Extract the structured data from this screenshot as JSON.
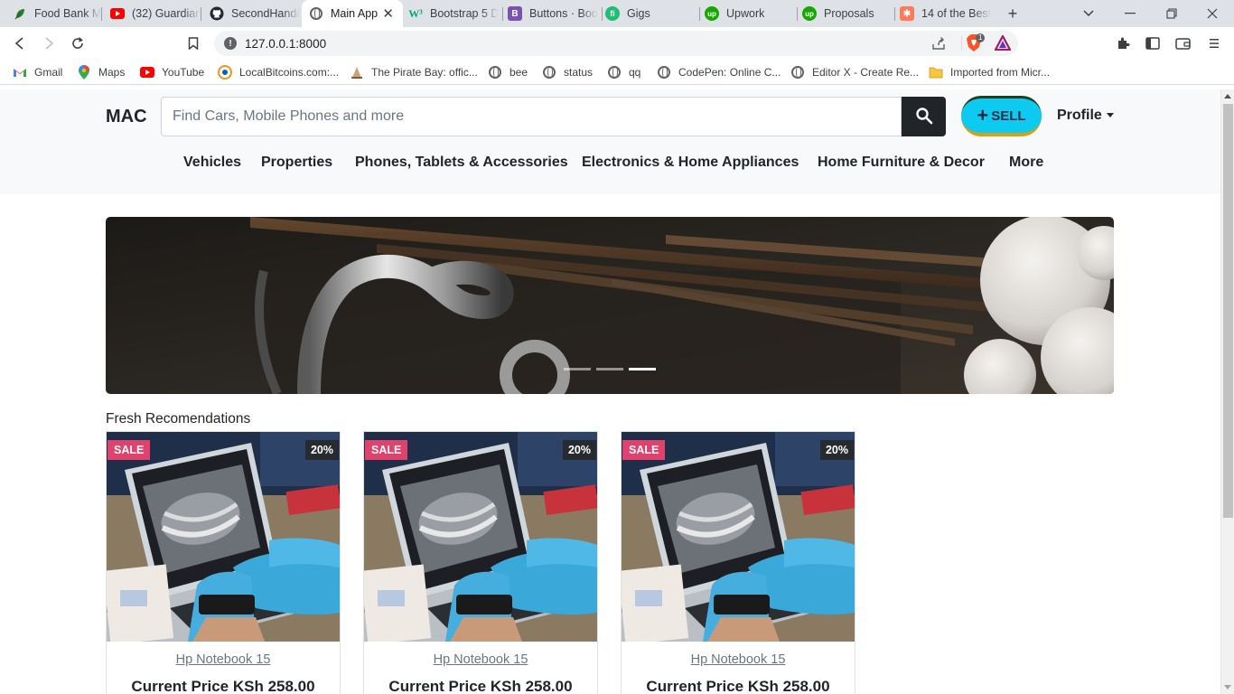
{
  "browser": {
    "tabs": [
      {
        "title": "Food Bank Ma",
        "icon": "leaf-icon",
        "color": "#2e7d32"
      },
      {
        "title": "(32) Guardian",
        "icon": "youtube-icon",
        "color": "#ff0000"
      },
      {
        "title": "SecondHand/",
        "icon": "github-icon",
        "color": "#24292f"
      },
      {
        "title": "Main App",
        "icon": "globe-icon",
        "color": "#5f6368",
        "active": true
      },
      {
        "title": "Bootstrap 5 D",
        "icon": "w3-icon",
        "color": "#04aa6d"
      },
      {
        "title": "Buttons · Boo",
        "icon": "bootstrap-icon",
        "color": "#7952b3"
      },
      {
        "title": "Gigs",
        "icon": "fiverr-icon",
        "color": "#1dbf73"
      },
      {
        "title": "Upwork",
        "icon": "upwork-icon",
        "color": "#14a800"
      },
      {
        "title": "Proposals",
        "icon": "upwork-icon",
        "color": "#14a800"
      },
      {
        "title": "14 of the Best",
        "icon": "hubspot-icon",
        "color": "#ff7a59"
      }
    ],
    "url": "127.0.0.1:8000",
    "bookmarks": [
      {
        "label": "Gmail",
        "icon": "gmail-icon"
      },
      {
        "label": "Maps",
        "icon": "maps-icon"
      },
      {
        "label": "YouTube",
        "icon": "youtube-icon"
      },
      {
        "label": "LocalBitcoins.com:...",
        "icon": "localbitcoins-icon"
      },
      {
        "label": "The Pirate Bay: offic...",
        "icon": "pirate-bay-icon"
      },
      {
        "label": "bee",
        "icon": "globe-icon"
      },
      {
        "label": "status",
        "icon": "globe-icon"
      },
      {
        "label": "qq",
        "icon": "globe-icon"
      },
      {
        "label": "CodePen: Online C...",
        "icon": "globe-icon"
      },
      {
        "label": "Editor X - Create Re...",
        "icon": "globe-icon"
      },
      {
        "label": "Imported from Micr...",
        "icon": "folder-icon"
      }
    ],
    "brave_badge": "1"
  },
  "site": {
    "brand": "MAC",
    "search_placeholder": "Find Cars, Mobile Phones and more",
    "sell_label": "SELL",
    "profile_label": "Profile",
    "categories": [
      "Vehicles",
      "Properties",
      "Phones, Tablets & Accessories",
      "Electronics & Home Appliances",
      "Home Furniture & Decor",
      "More"
    ],
    "carousel": {
      "slides": 3,
      "active_slide": 3
    },
    "section_title": "Fresh Recomendations",
    "products": [
      {
        "badge": "SALE",
        "discount": "20%",
        "name": "Hp Notebook 15",
        "price": "Current Price KSh 258.00"
      },
      {
        "badge": "SALE",
        "discount": "20%",
        "name": "Hp Notebook 15",
        "price": "Current Price KSh 258.00"
      },
      {
        "badge": "SALE",
        "discount": "20%",
        "name": "Hp Notebook 15",
        "price": "Current Price KSh 258.00"
      }
    ],
    "colors": {
      "accent": "#0dcaf0",
      "sale": "#e0426e",
      "dark": "#212529"
    }
  }
}
